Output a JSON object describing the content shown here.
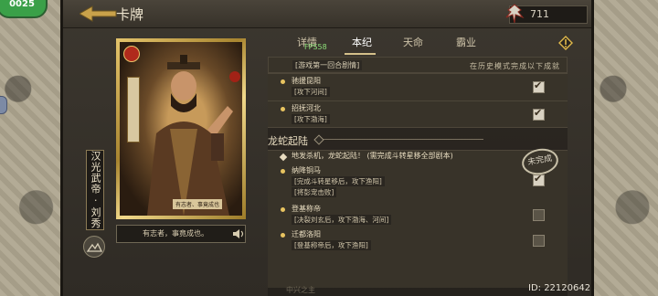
{
  "header": {
    "title": "卡牌",
    "currency_value": "711"
  },
  "card": {
    "quote": "有志者，事竟成也。",
    "name": "汉光武帝 · 刘秀",
    "card_quote_small": "有志者、事竟成也"
  },
  "tabs": [
    {
      "label": "详情"
    },
    {
      "label": "本纪"
    },
    {
      "label": "天命"
    },
    {
      "label": "霸业"
    }
  ],
  "fps": "FPS58",
  "list": {
    "pre_sub": "[游戏第一回合剧情]",
    "hint": "在历史模式完成以下成就",
    "quests_top": [
      {
        "title": "驰援昆阳",
        "sub": "[攻下河间]",
        "checked": true
      },
      {
        "title": "招抚河北",
        "sub": "[攻下渤海]",
        "checked": true
      }
    ],
    "section_title": "龙蛇起陆",
    "section_sub": "地发杀机，龙蛇起陆！ (需完成斗转星移全部剧本)",
    "done_stamp": "未完成",
    "quests_bottom": [
      {
        "title": "纳降铜马",
        "subs": [
          "[完成斗转星移后，攻下渔阳]",
          "[将彭宠击败]"
        ],
        "checked": true
      },
      {
        "title": "登基称帝",
        "subs": [
          "[决裂刘玄后，攻下渤海、河间]"
        ],
        "checked": false
      },
      {
        "title": "迁都洛阳",
        "subs": [
          "[登基称帝后，攻下渔阳]"
        ],
        "checked": false
      }
    ],
    "footer_hint": "中兴之主"
  },
  "footer": {
    "id_text": "ID: 22120642"
  },
  "badge": "0025",
  "colors": {
    "gold": "#e8c460",
    "background": "#2f2b25",
    "green_fps": "#8de07a"
  }
}
